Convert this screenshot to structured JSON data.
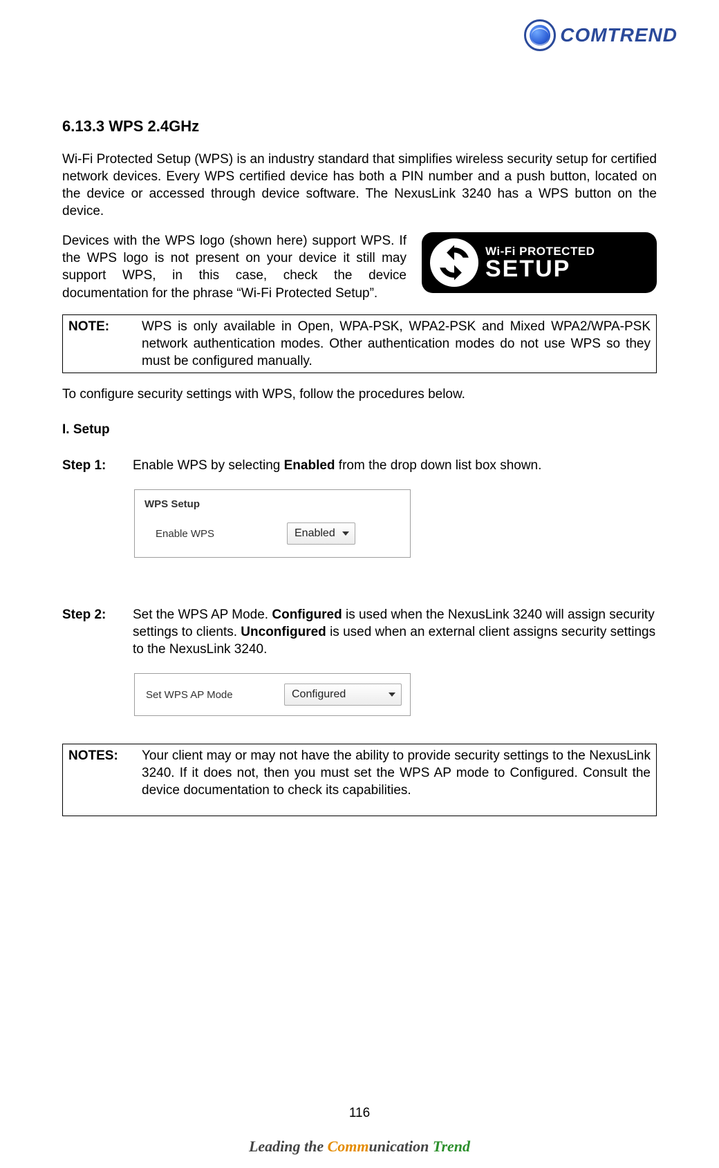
{
  "brand": {
    "name": "COMTREND"
  },
  "heading": "6.13.3 WPS 2.4GHz",
  "intro_paragraph": "Wi-Fi Protected Setup (WPS) is an industry standard that simplifies wireless security setup for certified network devices. Every WPS certified device has both a PIN number and a push button, located on the device or accessed through device software. The NexusLink 3240 has a WPS button on the device.",
  "logo_paragraph": "Devices with the WPS logo (shown here) support WPS. If the WPS logo is not present on your device it still may support WPS, in this case, check the device documentation for the phrase “Wi-Fi Protected Setup”.",
  "wps_logo": {
    "line1": "Wi-Fi PROTECTED",
    "line2": "SETUP"
  },
  "note1": {
    "label": "NOTE:",
    "body": "WPS is only available in Open, WPA-PSK, WPA2-PSK and Mixed WPA2/WPA-PSK network authentication modes.  Other authentication modes do not use WPS so they must be configured manually."
  },
  "configure_line": "To configure security settings with WPS, follow the procedures below.",
  "setup_heading": "I. Setup",
  "step1": {
    "label": "Step 1:",
    "pre": "Enable WPS by selecting ",
    "bold": "Enabled",
    "post": " from the drop down list box shown."
  },
  "panel1": {
    "title": "WPS Setup",
    "row_label": "Enable WPS",
    "select_value": "Enabled"
  },
  "step2": {
    "label": "Step 2:",
    "t1": "Set the WPS AP Mode. ",
    "b1": "Configured",
    "t2": " is used when the NexusLink 3240 will assign security settings to clients. ",
    "b2": "Unconfigured",
    "t3": " is used when an external client assigns security settings to the NexusLink 3240."
  },
  "panel2": {
    "row_label": "Set WPS AP Mode",
    "select_value": "Configured"
  },
  "note2": {
    "label": "NOTES:",
    "body": "Your client may or may not have the ability to provide security settings to the NexusLink 3240. If it does not, then you must set the WPS AP mode to Configured. Consult the device documentation to check its capabilities."
  },
  "page_number": "116",
  "footer": {
    "t1": "Leading the ",
    "t2": "Comm",
    "t3": "unication ",
    "t4": "Trend"
  }
}
